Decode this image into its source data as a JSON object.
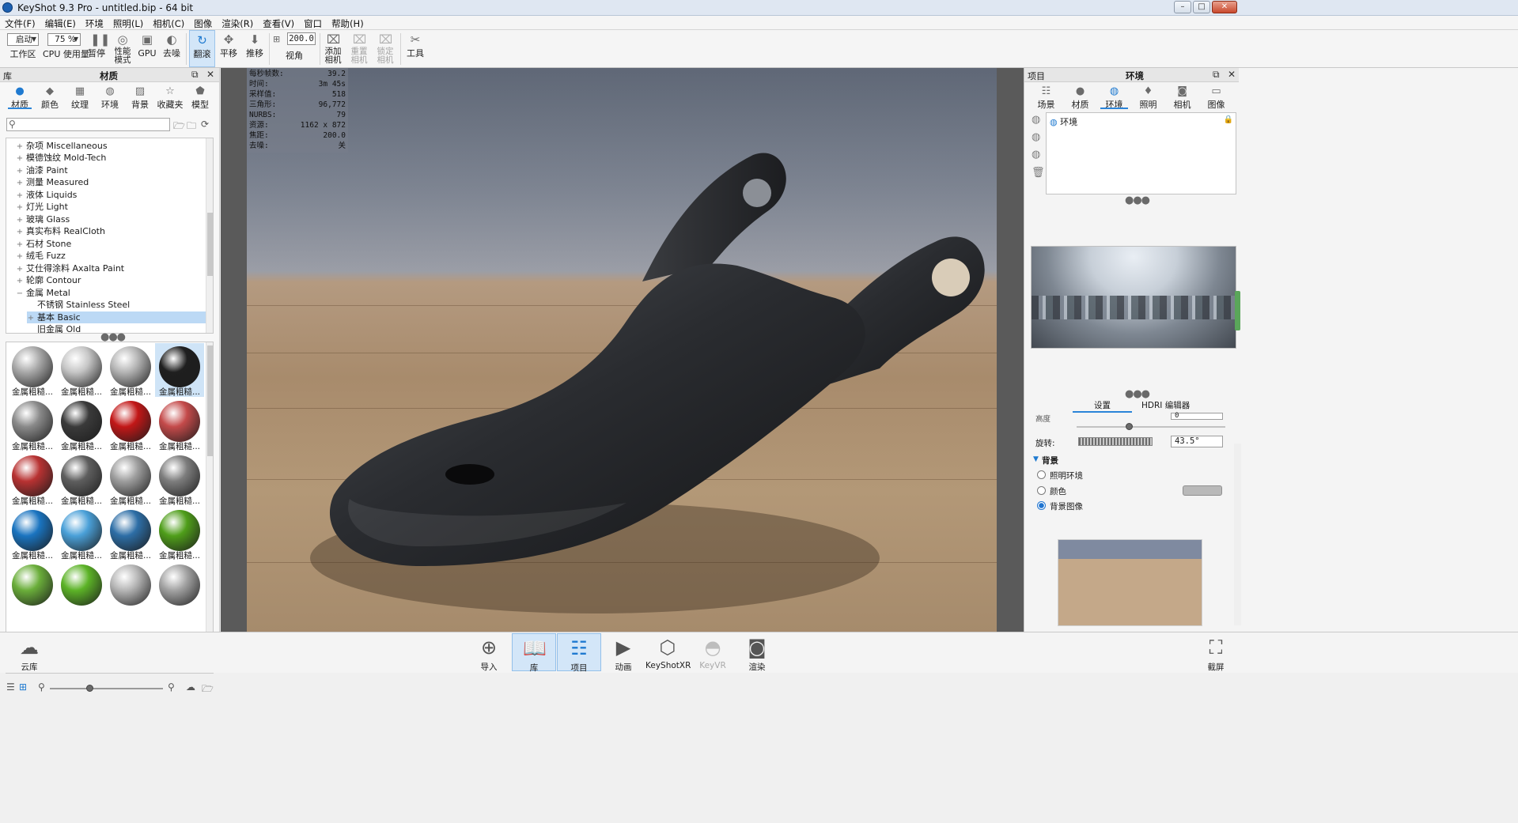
{
  "window": {
    "title": "KeyShot 9.3 Pro  - untitled.bip  - 64 bit",
    "buttons": {
      "minimize": "–",
      "maximize": "□",
      "close": "✕"
    }
  },
  "menu": [
    "文件(F)",
    "编辑(E)",
    "环境",
    "照明(L)",
    "相机(C)",
    "图像",
    "渲染(R)",
    "查看(V)",
    "窗口",
    "帮助(H)"
  ],
  "toolbar": {
    "workspace_select": "启动",
    "workspace_label": "工作区",
    "cpu_select": "75 %",
    "cpu_label": "CPU 使用量",
    "pause_label": "暂停",
    "perf_label_1": "性能",
    "perf_label_2": "模式",
    "gpu_label": "GPU",
    "denoise_label": "去噪",
    "tumble_label": "翻滚",
    "pan_label": "平移",
    "dolly_label": "推移",
    "fov_value": "200.0",
    "fov_label": "视角",
    "add_camera_1": "添加",
    "add_camera_2": "相机",
    "reset_camera_1": "重置",
    "reset_camera_2": "相机",
    "lock_camera_1": "锁定",
    "lock_camera_2": "相机",
    "tools_label": "工具"
  },
  "library": {
    "header_left": "库",
    "header_title": "材质",
    "tabs": [
      {
        "label": "材质",
        "icon": "material-icon"
      },
      {
        "label": "颜色",
        "icon": "color-icon"
      },
      {
        "label": "纹理",
        "icon": "texture-icon"
      },
      {
        "label": "环境",
        "icon": "environment-icon"
      },
      {
        "label": "背景",
        "icon": "background-icon"
      },
      {
        "label": "收藏夹",
        "icon": "favorites-icon"
      },
      {
        "label": "模型",
        "icon": "model-icon"
      }
    ],
    "tree": [
      {
        "label": "杂项 Miscellaneous",
        "toggle": "+"
      },
      {
        "label": "模德蚀纹 Mold-Tech",
        "toggle": "+"
      },
      {
        "label": "油漆 Paint",
        "toggle": "+"
      },
      {
        "label": "测量 Measured",
        "toggle": "+"
      },
      {
        "label": "液体 Liquids",
        "toggle": "+"
      },
      {
        "label": "灯光 Light",
        "toggle": "+"
      },
      {
        "label": "玻璃 Glass",
        "toggle": "+"
      },
      {
        "label": "真实布料 RealCloth",
        "toggle": "+"
      },
      {
        "label": "石材 Stone",
        "toggle": "+"
      },
      {
        "label": "绒毛 Fuzz",
        "toggle": "+"
      },
      {
        "label": "艾仕得涂料 Axalta Paint",
        "toggle": "+"
      },
      {
        "label": "轮廓 Contour",
        "toggle": "+"
      },
      {
        "label": "金属 Metal",
        "toggle": "−"
      },
      {
        "label": "不锈钢 Stainless Steel",
        "toggle": ""
      },
      {
        "label": "基本 Basic",
        "toggle": "+"
      },
      {
        "label": "旧金属 Old",
        "toggle": ""
      }
    ],
    "materials": [
      {
        "label": "金属粗糙...",
        "color": "#a9a9a9",
        "selected": false
      },
      {
        "label": "金属粗糙...",
        "color": "#c6c6c6",
        "selected": false
      },
      {
        "label": "金属粗糙...",
        "color": "#b5b5b5",
        "selected": false
      },
      {
        "label": "金属粗糙...",
        "color": "#1f1f1f",
        "selected": true
      },
      {
        "label": "金属粗糙...",
        "color": "#8a8a8a",
        "selected": false
      },
      {
        "label": "金属粗糙...",
        "color": "#3a3a3a",
        "selected": false
      },
      {
        "label": "金属粗糙...",
        "color": "#c21717",
        "selected": false
      },
      {
        "label": "金属粗糙...",
        "color": "#c44a4a",
        "selected": false
      },
      {
        "label": "金属粗糙...",
        "color": "#b83232",
        "selected": false
      },
      {
        "label": "金属粗糙...",
        "color": "#5e5e5e",
        "selected": false
      },
      {
        "label": "金属粗糙...",
        "color": "#9d9d9d",
        "selected": false
      },
      {
        "label": "金属粗糙...",
        "color": "#7d7d7d",
        "selected": false
      },
      {
        "label": "金属粗糙...",
        "color": "#1a74c0",
        "selected": false
      },
      {
        "label": "金属粗糙...",
        "color": "#4aa0d8",
        "selected": false
      },
      {
        "label": "金属粗糙...",
        "color": "#2d6ea6",
        "selected": false
      },
      {
        "label": "金属粗糙...",
        "color": "#4f9e1a",
        "selected": false
      },
      {
        "label": "",
        "color": "#6aae3a",
        "selected": false
      },
      {
        "label": "",
        "color": "#5cb327",
        "selected": false
      },
      {
        "label": "",
        "color": "#b6b6b6",
        "selected": false
      },
      {
        "label": "",
        "color": "#a3a3a3",
        "selected": false
      }
    ]
  },
  "stats": [
    {
      "key": "每秒帧数:",
      "value": "39.2"
    },
    {
      "key": "时间:",
      "value": "3m 45s"
    },
    {
      "key": "采样值:",
      "value": "518"
    },
    {
      "key": "三角形:",
      "value": "96,772"
    },
    {
      "key": "NURBS:",
      "value": "79"
    },
    {
      "key": "资源:",
      "value": "1162 x 872"
    },
    {
      "key": "焦距:",
      "value": "200.0"
    },
    {
      "key": "去噪:",
      "value": "关"
    }
  ],
  "project": {
    "header_left": "项目",
    "header_title": "环境",
    "tabs": [
      {
        "label": "场景",
        "icon": "scene-icon"
      },
      {
        "label": "材质",
        "icon": "material-icon"
      },
      {
        "label": "环境",
        "icon": "environment-icon"
      },
      {
        "label": "照明",
        "icon": "lighting-icon"
      },
      {
        "label": "相机",
        "icon": "camera-icon"
      },
      {
        "label": "图像",
        "icon": "image-icon"
      }
    ],
    "env_item": "环境",
    "subtab_settings": "设置",
    "subtab_hdri": "HDRI 编辑器",
    "height_label": "高度",
    "height_value": "0",
    "rotation_label": "旋转:",
    "rotation_value": "43.5°",
    "background_section": "背景",
    "bg_options": [
      "照明环境",
      "颜色",
      "背景图像"
    ],
    "bg_selected": 2
  },
  "bottom": {
    "cloud_label": "云库",
    "import_label": "导入",
    "library_label": "库",
    "project_label": "项目",
    "animation_label": "动画",
    "keyshotxr_label": "KeyShotXR",
    "keyvr_label": "KeyVR",
    "render_label": "渲染",
    "screenshot_label": "截屏"
  }
}
